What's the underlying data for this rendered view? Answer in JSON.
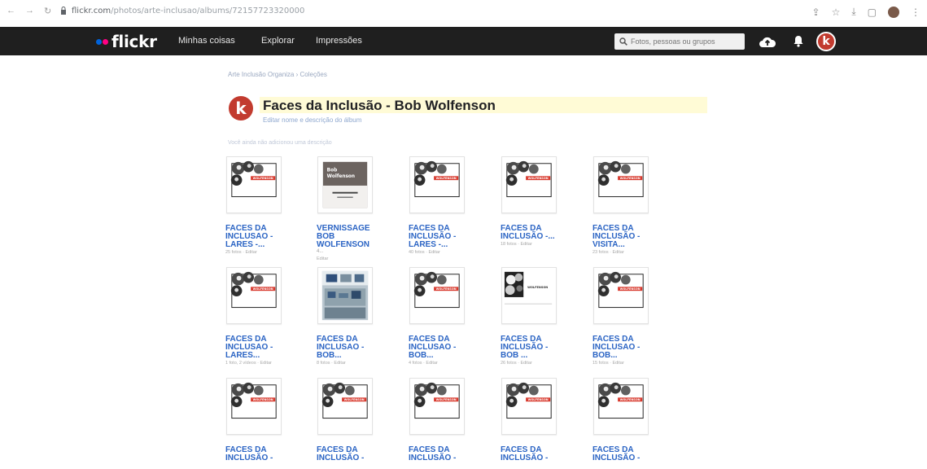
{
  "browser": {
    "url_host": "flickr.com",
    "url_path": "/photos/arte-inclusao/albums/72157723320000"
  },
  "header": {
    "logo_text": "flickr",
    "nav": [
      "Minhas coisas",
      "Explorar",
      "Impressões"
    ],
    "search_placeholder": "Fotos, pessoas ou grupos",
    "avatar_letter": "k"
  },
  "album": {
    "breadcrumb": "Arte Inclusão Organiza › Coleções",
    "title": "Faces da Inclusão - Bob Wolfenson",
    "subtitle": "Editar nome e descrição do álbum",
    "hint": "Você ainda não adicionou uma descrição",
    "avatar_letter": "k"
  },
  "items": [
    {
      "line1": "FACES DA",
      "line2": "INCLUSAO -",
      "line3": "LARES -...",
      "meta": "25 fotos · Editar",
      "thumb": "faces"
    },
    {
      "line1": "VERNISSAGE",
      "line2": "BOB",
      "line3": "WOLFENSON",
      "line4": "4...",
      "meta": "Editar",
      "thumb": "book"
    },
    {
      "line1": "FACES DA",
      "line2": "INCLUSÃO -",
      "line3": "LARES -...",
      "meta": "40 fotos · Editar",
      "thumb": "faces"
    },
    {
      "line1": "FACES DA",
      "line2": "INCLUSÃO -...",
      "line3": "",
      "meta": "18 fotos · Editar",
      "thumb": "faces"
    },
    {
      "line1": "FACES DA",
      "line2": "INCLUSÃO -",
      "line3": "VISITA...",
      "meta": "23 fotos · Editar",
      "thumb": "faces"
    },
    {
      "line1": "FACES DA",
      "line2": "INCLUSAO -",
      "line3": "LARES...",
      "meta": "1 foto, 2 vídeos · Editar",
      "thumb": "faces"
    },
    {
      "line1": "FACES DA",
      "line2": "INCLUSAO -",
      "line3": "BOB...",
      "meta": "8 fotos · Editar",
      "thumb": "room"
    },
    {
      "line1": "FACES DA",
      "line2": "INCLUSAO -",
      "line3": "BOB...",
      "meta": "4 fotos · Editar",
      "thumb": "faces"
    },
    {
      "line1": "FACES DA",
      "line2": "INCLUSÃO -",
      "line3": "BOB ...",
      "meta": "26 fotos · Editar",
      "thumb": "bw"
    },
    {
      "line1": "FACES DA",
      "line2": "INCLUSAO -",
      "line3": "BOB...",
      "meta": "15 fotos · Editar",
      "thumb": "faces"
    },
    {
      "line1": "FACES DA",
      "line2": "INCLUSÃO -",
      "line3": "",
      "meta": "",
      "thumb": "faces"
    },
    {
      "line1": "FACES DA",
      "line2": "INCLUSÃO -",
      "line3": "",
      "meta": "",
      "thumb": "faces"
    },
    {
      "line1": "FACES DA",
      "line2": "INCLUSÃO -",
      "line3": "",
      "meta": "",
      "thumb": "faces"
    },
    {
      "line1": "FACES DA",
      "line2": "INCLUSÃO -",
      "line3": "",
      "meta": "",
      "thumb": "faces"
    },
    {
      "line1": "FACES DA",
      "line2": "INCLUSÃO -",
      "line3": "",
      "meta": "",
      "thumb": "faces"
    }
  ],
  "thumb_wordmark": "WOLFENSON",
  "book_line1": "Bob",
  "book_line2": "Wolfenson",
  "colors": {
    "flickr_blue": "#0063dc",
    "flickr_pink": "#ff0084",
    "link_blue": "#2b64c4",
    "topbar": "#1f1f1f",
    "avatar_red": "#c23b2f"
  }
}
